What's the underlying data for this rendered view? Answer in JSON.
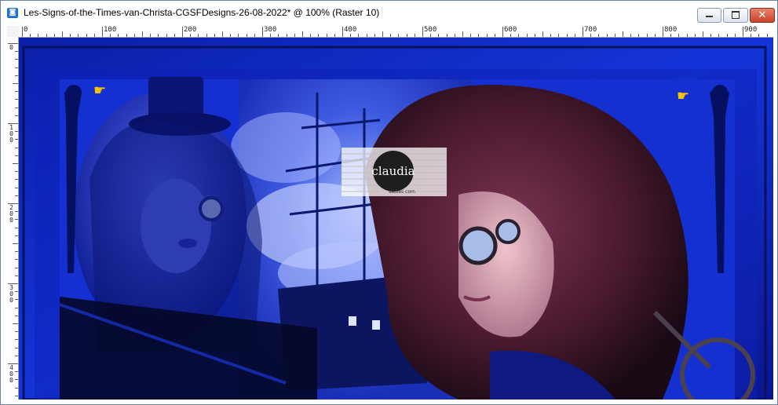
{
  "window": {
    "title": "Les-Signs-of-the-Times-van-Christa-CGSFDesigns-26-08-2022* @ 100% (Raster 10)"
  },
  "controls": {
    "minimize_icon": "minimize-icon",
    "maximize_icon": "maximize-icon",
    "close_glyph": "✕"
  },
  "rulers": {
    "top_labels": [
      "0",
      "100",
      "200",
      "300",
      "400",
      "500",
      "600",
      "700",
      "800",
      "900"
    ],
    "left_labels": [
      "0",
      "1 0 0",
      "2 0 0",
      "3 0 0",
      "4 0 0"
    ]
  },
  "canvas": {
    "watermark_text": "claudia",
    "watermark_subtext": "sadies com",
    "colors": {
      "deep_blue": "#0a1a90",
      "mid_blue": "#1d3ef0",
      "dark": "#05082c",
      "hair": "#5a2038",
      "skin": "#d9a8b5"
    },
    "icons": [
      "pointing-hand-icon",
      "pointing-hand-icon"
    ]
  }
}
